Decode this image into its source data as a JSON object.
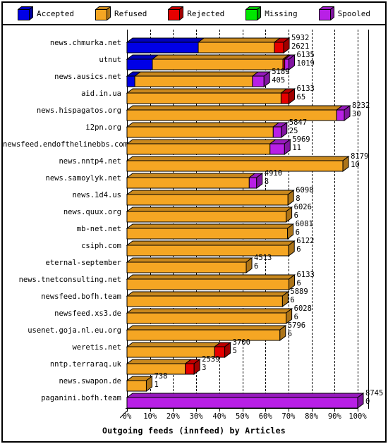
{
  "legend": {
    "items": [
      {
        "label": "Accepted",
        "color": "#0000e6",
        "icon": "cube-icon"
      },
      {
        "label": "Refused",
        "color": "#f5a623",
        "icon": "cube-icon"
      },
      {
        "label": "Rejected",
        "color": "#e60000",
        "icon": "cube-icon"
      },
      {
        "label": "Missing",
        "color": "#00e600",
        "icon": "cube-icon"
      },
      {
        "label": "Spooled",
        "color": "#b820e6",
        "icon": "cube-icon"
      }
    ]
  },
  "axis": {
    "x_ticks": [
      "0%",
      "10%",
      "20%",
      "30%",
      "40%",
      "50%",
      "60%",
      "70%",
      "80%",
      "90%",
      "100%"
    ],
    "title": "Outgoing feeds (innfeed) by Articles"
  },
  "chart_data": {
    "type": "bar",
    "orientation": "horizontal",
    "stacked": true,
    "title": "Outgoing feeds (innfeed) by Articles",
    "xlabel": "",
    "ylabel": "",
    "xlim": [
      0,
      100
    ],
    "x_unit": "percent",
    "grid": true,
    "legend_position": "top",
    "series": [
      {
        "name": "Accepted",
        "color": "#0000e6"
      },
      {
        "name": "Refused",
        "color": "#f5a623"
      },
      {
        "name": "Rejected",
        "color": "#e60000"
      },
      {
        "name": "Missing",
        "color": "#00e600"
      },
      {
        "name": "Spooled",
        "color": "#b820e6"
      }
    ],
    "categories": [
      "news.chmurka.net",
      "utnut",
      "news.ausics.net",
      "aid.in.ua",
      "news.hispagatos.org",
      "i2pn.org",
      "newsfeed.endofthelinebbs.com",
      "news.nntp4.net",
      "news.samoylyk.net",
      "news.1d4.us",
      "news.quux.org",
      "mb-net.net",
      "csiph.com",
      "eternal-september",
      "news.tnetconsulting.net",
      "newsfeed.bofh.team",
      "newsfeed.xs3.de",
      "usenet.goja.nl.eu.org",
      "weretis.net",
      "nntp.terraraq.uk",
      "news.swapon.de",
      "paganini.bofh.team"
    ],
    "rows": [
      {
        "label": "news.chmurka.net",
        "total": 5932,
        "second": 2621,
        "total_pct": 67.9,
        "segments": [
          {
            "series": "Accepted",
            "pct": 30.9
          },
          {
            "series": "Refused",
            "pct": 33.0
          },
          {
            "series": "Rejected",
            "pct": 4.0
          }
        ]
      },
      {
        "label": "utnut",
        "total": 6135,
        "second": 1019,
        "total_pct": 70.2,
        "segments": [
          {
            "series": "Accepted",
            "pct": 11.0
          },
          {
            "series": "Refused",
            "pct": 56.6
          },
          {
            "series": "Rejected",
            "pct": 0.8
          },
          {
            "series": "Spooled",
            "pct": 1.8
          }
        ]
      },
      {
        "label": "news.ausics.net",
        "total": 5189,
        "second": 405,
        "total_pct": 59.4,
        "segments": [
          {
            "series": "Accepted",
            "pct": 3.4
          },
          {
            "series": "Refused",
            "pct": 51.0
          },
          {
            "series": "Spooled",
            "pct": 5.0
          }
        ]
      },
      {
        "label": "aid.in.ua",
        "total": 6133,
        "second": 65,
        "total_pct": 70.2,
        "segments": [
          {
            "series": "Refused",
            "pct": 66.8
          },
          {
            "series": "Rejected",
            "pct": 3.4
          }
        ]
      },
      {
        "label": "news.hispagatos.org",
        "total": 8232,
        "second": 30,
        "total_pct": 94.2,
        "segments": [
          {
            "series": "Refused",
            "pct": 90.9
          },
          {
            "series": "Spooled",
            "pct": 3.3
          }
        ]
      },
      {
        "label": "i2pn.org",
        "total": 5847,
        "second": 25,
        "total_pct": 66.9,
        "segments": [
          {
            "series": "Refused",
            "pct": 63.4
          },
          {
            "series": "Spooled",
            "pct": 3.5
          }
        ]
      },
      {
        "label": "newsfeed.endofthelinebbs.com",
        "total": 5969,
        "second": 11,
        "total_pct": 68.3,
        "segments": [
          {
            "series": "Refused",
            "pct": 62.0
          },
          {
            "series": "Spooled",
            "pct": 6.3
          }
        ]
      },
      {
        "label": "news.nntp4.net",
        "total": 8179,
        "second": 10,
        "total_pct": 93.6,
        "segments": [
          {
            "series": "Refused",
            "pct": 93.6
          }
        ]
      },
      {
        "label": "news.samoylyk.net",
        "total": 4910,
        "second": 8,
        "total_pct": 56.2,
        "segments": [
          {
            "series": "Refused",
            "pct": 53.0
          },
          {
            "series": "Spooled",
            "pct": 3.2
          }
        ]
      },
      {
        "label": "news.1d4.us",
        "total": 6098,
        "second": 8,
        "total_pct": 69.8,
        "segments": [
          {
            "series": "Refused",
            "pct": 69.8
          }
        ]
      },
      {
        "label": "news.quux.org",
        "total": 6026,
        "second": 6,
        "total_pct": 69.0,
        "segments": [
          {
            "series": "Refused",
            "pct": 69.0
          }
        ]
      },
      {
        "label": "mb-net.net",
        "total": 6081,
        "second": 6,
        "total_pct": 69.6,
        "segments": [
          {
            "series": "Refused",
            "pct": 69.6
          }
        ]
      },
      {
        "label": "csiph.com",
        "total": 6122,
        "second": 6,
        "total_pct": 70.1,
        "segments": [
          {
            "series": "Refused",
            "pct": 70.1
          }
        ]
      },
      {
        "label": "eternal-september",
        "total": 4513,
        "second": 6,
        "total_pct": 51.7,
        "segments": [
          {
            "series": "Refused",
            "pct": 51.7
          }
        ]
      },
      {
        "label": "news.tnetconsulting.net",
        "total": 6133,
        "second": 6,
        "total_pct": 70.2,
        "segments": [
          {
            "series": "Refused",
            "pct": 70.2
          }
        ]
      },
      {
        "label": "newsfeed.bofh.team",
        "total": 5889,
        "second": 6,
        "total_pct": 67.4,
        "segments": [
          {
            "series": "Refused",
            "pct": 67.4
          }
        ]
      },
      {
        "label": "newsfeed.xs3.de",
        "total": 6028,
        "second": 6,
        "total_pct": 69.0,
        "segments": [
          {
            "series": "Refused",
            "pct": 69.0
          }
        ]
      },
      {
        "label": "usenet.goja.nl.eu.org",
        "total": 5796,
        "second": 6,
        "total_pct": 66.3,
        "segments": [
          {
            "series": "Refused",
            "pct": 66.3
          }
        ]
      },
      {
        "label": "weretis.net",
        "total": 3700,
        "second": 5,
        "total_pct": 42.4,
        "segments": [
          {
            "series": "Refused",
            "pct": 38.0
          },
          {
            "series": "Rejected",
            "pct": 4.4
          }
        ]
      },
      {
        "label": "nntp.terraraq.uk",
        "total": 2539,
        "second": 3,
        "total_pct": 29.1,
        "segments": [
          {
            "series": "Refused",
            "pct": 25.3
          },
          {
            "series": "Rejected",
            "pct": 3.8
          }
        ]
      },
      {
        "label": "news.swapon.de",
        "total": 738,
        "second": 1,
        "total_pct": 8.4,
        "segments": [
          {
            "series": "Refused",
            "pct": 8.4
          }
        ]
      },
      {
        "label": "paganini.bofh.team",
        "total": 8745,
        "second": 0,
        "total_pct": 100.0,
        "segments": [
          {
            "series": "Spooled",
            "pct": 100.0
          }
        ]
      }
    ]
  }
}
